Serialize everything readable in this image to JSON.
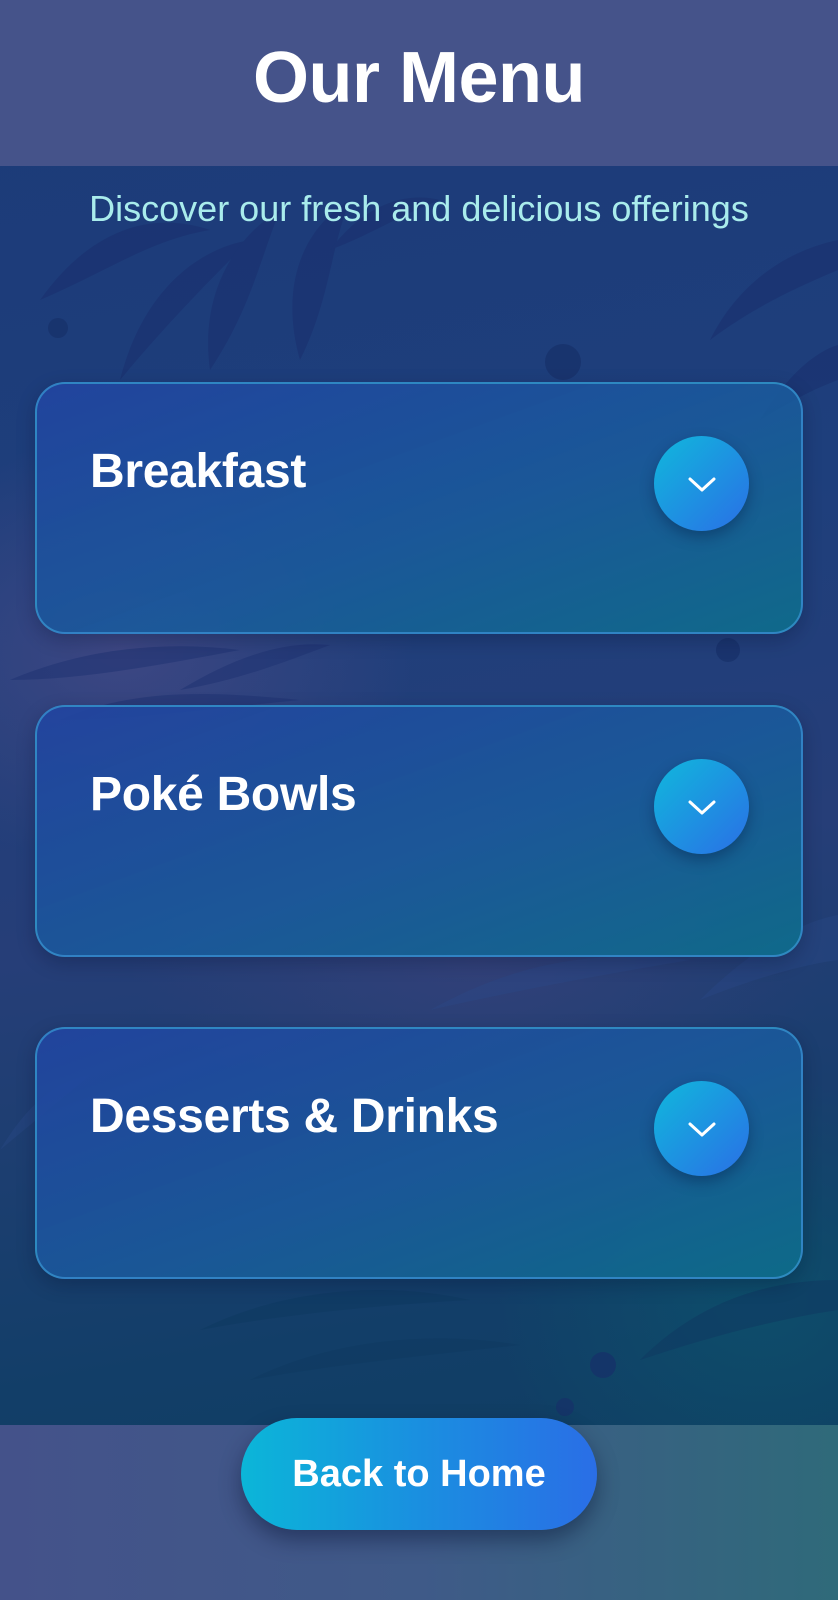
{
  "header": {
    "title": "Our Menu"
  },
  "subtitle": "Discover our fresh and delicious offerings",
  "categories": [
    {
      "label": "Breakfast",
      "icon": "chevron-down-icon"
    },
    {
      "label": "Poké Bowls",
      "icon": "chevron-down-icon"
    },
    {
      "label": "Desserts & Drinks",
      "icon": "chevron-down-icon"
    }
  ],
  "footer": {
    "button_label": "Back to Home"
  },
  "colors": {
    "header_bg": "#45538a",
    "subtitle_text": "#a9ecec",
    "accent_start": "#0bb6d8",
    "accent_end": "#2a6ee6",
    "card_border": "#3896d2"
  }
}
